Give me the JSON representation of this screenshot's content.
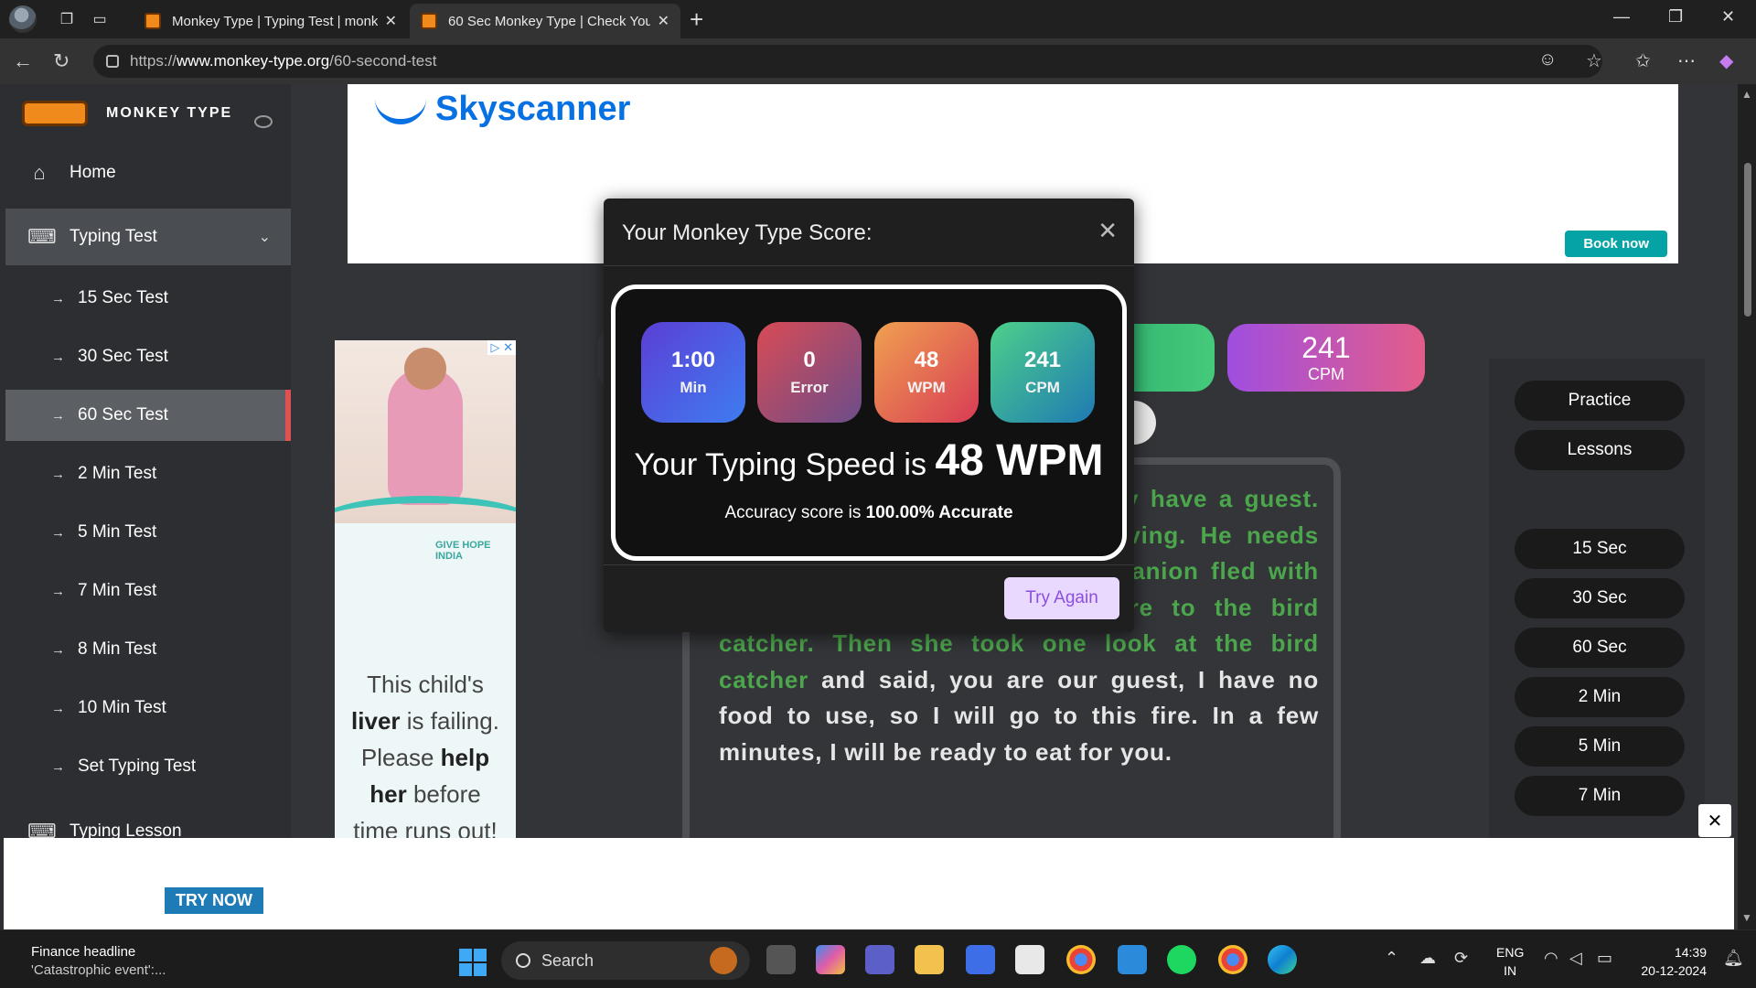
{
  "browser": {
    "tabs": [
      {
        "title": "Monkey Type | Typing Test | monk",
        "active": false
      },
      {
        "title": "60 Sec Monkey Type | Check Your",
        "active": true
      }
    ],
    "url_prefix": "https://",
    "url_host": "www.monkey-type.org",
    "url_path": "/60-second-test"
  },
  "sidebar": {
    "brand": "MONKEY TYPE",
    "home": "Home",
    "group": "Typing Test",
    "items": [
      {
        "label": "15 Sec Test"
      },
      {
        "label": "30 Sec Test"
      },
      {
        "label": "60 Sec Test",
        "current": true
      },
      {
        "label": "2 Min Test"
      },
      {
        "label": "5 Min Test"
      },
      {
        "label": "7 Min Test"
      },
      {
        "label": "8 Min Test"
      },
      {
        "label": "10 Min Test"
      },
      {
        "label": "Set Typing Test"
      }
    ],
    "lesson": "Typing Lesson"
  },
  "ads": {
    "top_brand": "Skyscanner",
    "top_cta": "Book now",
    "left_org": "GIVE HOPE INDIA",
    "left_text_1": "This child's",
    "left_bold_1": "liver",
    "left_text_2": " is failing.",
    "left_text_3": "Please ",
    "left_bold_2": "help",
    "left_bold_3": "her",
    "left_text_4": " before",
    "left_text_5": "time runs out!",
    "bottom_cta": "TRY NOW"
  },
  "stats_bar": {
    "cpm_value": "241",
    "cpm_label": "CPM"
  },
  "passage": {
    "typed": "Beloved, do not be sad, currently have a guest. This mate is trembling and starving. He needs your help.Hearing this, the companion fled with the dried branches. She set fire to the bird catcher. Then she took one look at the bird catcher ",
    "untyped": "and said, you are our guest, I have no food to use, so I will go to this fire. In a few minutes, I will be ready to eat for you."
  },
  "right_panel": {
    "buttons": [
      "Practice",
      "Lessons"
    ],
    "durations": [
      "15 Sec",
      "30 Sec",
      "60 Sec",
      "2 Min",
      "5 Min",
      "7 Min"
    ]
  },
  "modal": {
    "title": "Your Monkey Type Score:",
    "tiles": [
      {
        "value": "1:00",
        "label": "Min"
      },
      {
        "value": "0",
        "label": "Error"
      },
      {
        "value": "48",
        "label": "WPM"
      },
      {
        "value": "241",
        "label": "CPM"
      }
    ],
    "speed_prefix": "Your Typing Speed is ",
    "speed_value": "48 WPM",
    "accuracy_prefix": "Accuracy score is ",
    "accuracy_value": "100.00% Accurate",
    "try_again": "Try Again"
  },
  "taskbar": {
    "news_title": "Finance headline",
    "news_sub": "'Catastrophic event':...",
    "search": "Search",
    "lang_1": "ENG",
    "lang_2": "IN",
    "time": "14:39",
    "date": "20-12-2024"
  },
  "colors": {
    "page_bg": "#323437",
    "typed_text": "#4ca64c",
    "current_item_marker": "#e05252",
    "try_again_text": "#8a4fe0"
  }
}
